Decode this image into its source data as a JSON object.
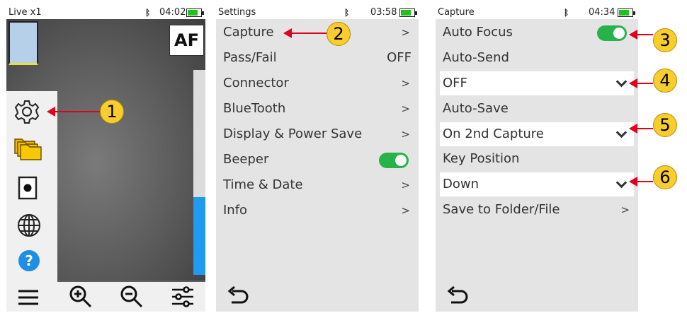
{
  "panel1": {
    "status_title": "Live x1",
    "clock": "04:02",
    "af_label": "AF",
    "icons": [
      "settings-gear-icon",
      "folders-icon",
      "record-icon",
      "globe-icon",
      "help-icon"
    ],
    "toolbar_icons": [
      "hamburger-menu-icon",
      "zoom-in-icon",
      "zoom-out-icon",
      "sliders-icon"
    ]
  },
  "panel2": {
    "status_title": "Settings",
    "clock": "03:58",
    "items": [
      {
        "label": "Capture",
        "value": ">"
      },
      {
        "label": "Pass/Fail",
        "value": "OFF"
      },
      {
        "label": "Connector",
        "value": ">"
      },
      {
        "label": "BlueTooth",
        "value": ">"
      },
      {
        "label": "Display & Power Save",
        "value": ">"
      },
      {
        "label": "Beeper",
        "value": ""
      },
      {
        "label": "Time & Date",
        "value": ">"
      },
      {
        "label": "Info",
        "value": ">"
      }
    ]
  },
  "panel3": {
    "status_title": "Capture",
    "clock": "04:34",
    "auto_focus": "Auto Focus",
    "auto_send": "Auto-Send",
    "auto_send_value": "OFF",
    "auto_save": "Auto-Save",
    "auto_save_value": "On 2nd Capture",
    "key_position": "Key Position",
    "key_position_value": "Down",
    "save_to": "Save to Folder/File",
    "save_to_chev": ">"
  },
  "callouts": [
    "1",
    "2",
    "3",
    "4",
    "5",
    "6"
  ],
  "colors": {
    "accent_green": "#27b24a",
    "callout_yellow": "#f9cd2c",
    "arrow_red": "#e0001b",
    "info_blue": "#1f8fe5"
  }
}
